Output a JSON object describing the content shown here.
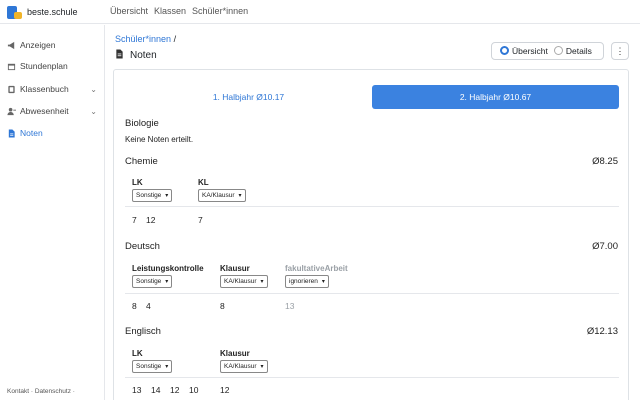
{
  "brand": {
    "name": "beste.schule"
  },
  "topnav": [
    "Übersicht",
    "Klassen",
    "Schüler*innen"
  ],
  "sidebar": {
    "items": [
      {
        "label": "Anzeigen",
        "icon": "megaphone-icon"
      },
      {
        "label": "Stundenplan",
        "icon": "calendar-icon"
      },
      {
        "label": "Klassenbuch",
        "icon": "book-icon"
      },
      {
        "label": "Abwesenheit",
        "icon": "user-minus-icon"
      },
      {
        "label": "Noten",
        "icon": "document-icon"
      }
    ],
    "footer": "Kontakt · Datenschutz ·"
  },
  "breadcrumb": {
    "link": "Schüler*innen",
    "sep": "/"
  },
  "page_title": "Noten",
  "view_toggle": {
    "option1": "Übersicht",
    "option2": "Details",
    "selected": "Übersicht"
  },
  "tabs": {
    "first": "1. Halbjahr Ø10.17",
    "second": "2. Halbjahr Ø10.67",
    "active": "second"
  },
  "subjects": {
    "biologie": {
      "name": "Biologie",
      "empty": "Keine Noten erteilt."
    },
    "chemie": {
      "name": "Chemie",
      "avg": "Ø8.25",
      "col1": {
        "label": "LK",
        "select": "Sonstige",
        "grades": [
          "7",
          "12"
        ]
      },
      "col2": {
        "label": "KL",
        "select": "KA/Klausur",
        "grades": [
          "7"
        ]
      }
    },
    "deutsch": {
      "name": "Deutsch",
      "avg": "Ø7.00",
      "col1": {
        "label": "Leistungskontrolle",
        "select": "Sonstige",
        "grades": [
          "8",
          "4"
        ]
      },
      "col2": {
        "label": "Klausur",
        "select": "KA/Klausur",
        "grades": [
          "8"
        ]
      },
      "col3": {
        "label": "fakultativeArbeit",
        "select": "ignorieren",
        "grades": [
          "13"
        ]
      }
    },
    "englisch": {
      "name": "Englisch",
      "avg": "Ø12.13",
      "col1": {
        "label": "LK",
        "select": "Sonstige",
        "grades": [
          "13",
          "14",
          "12",
          "10"
        ]
      },
      "col2": {
        "label": "Klausur",
        "select": "KA/Klausur",
        "grades": [
          "12"
        ]
      }
    }
  },
  "colors": {
    "accent": "#2f77d6",
    "tab_active": "#3b82e0"
  }
}
